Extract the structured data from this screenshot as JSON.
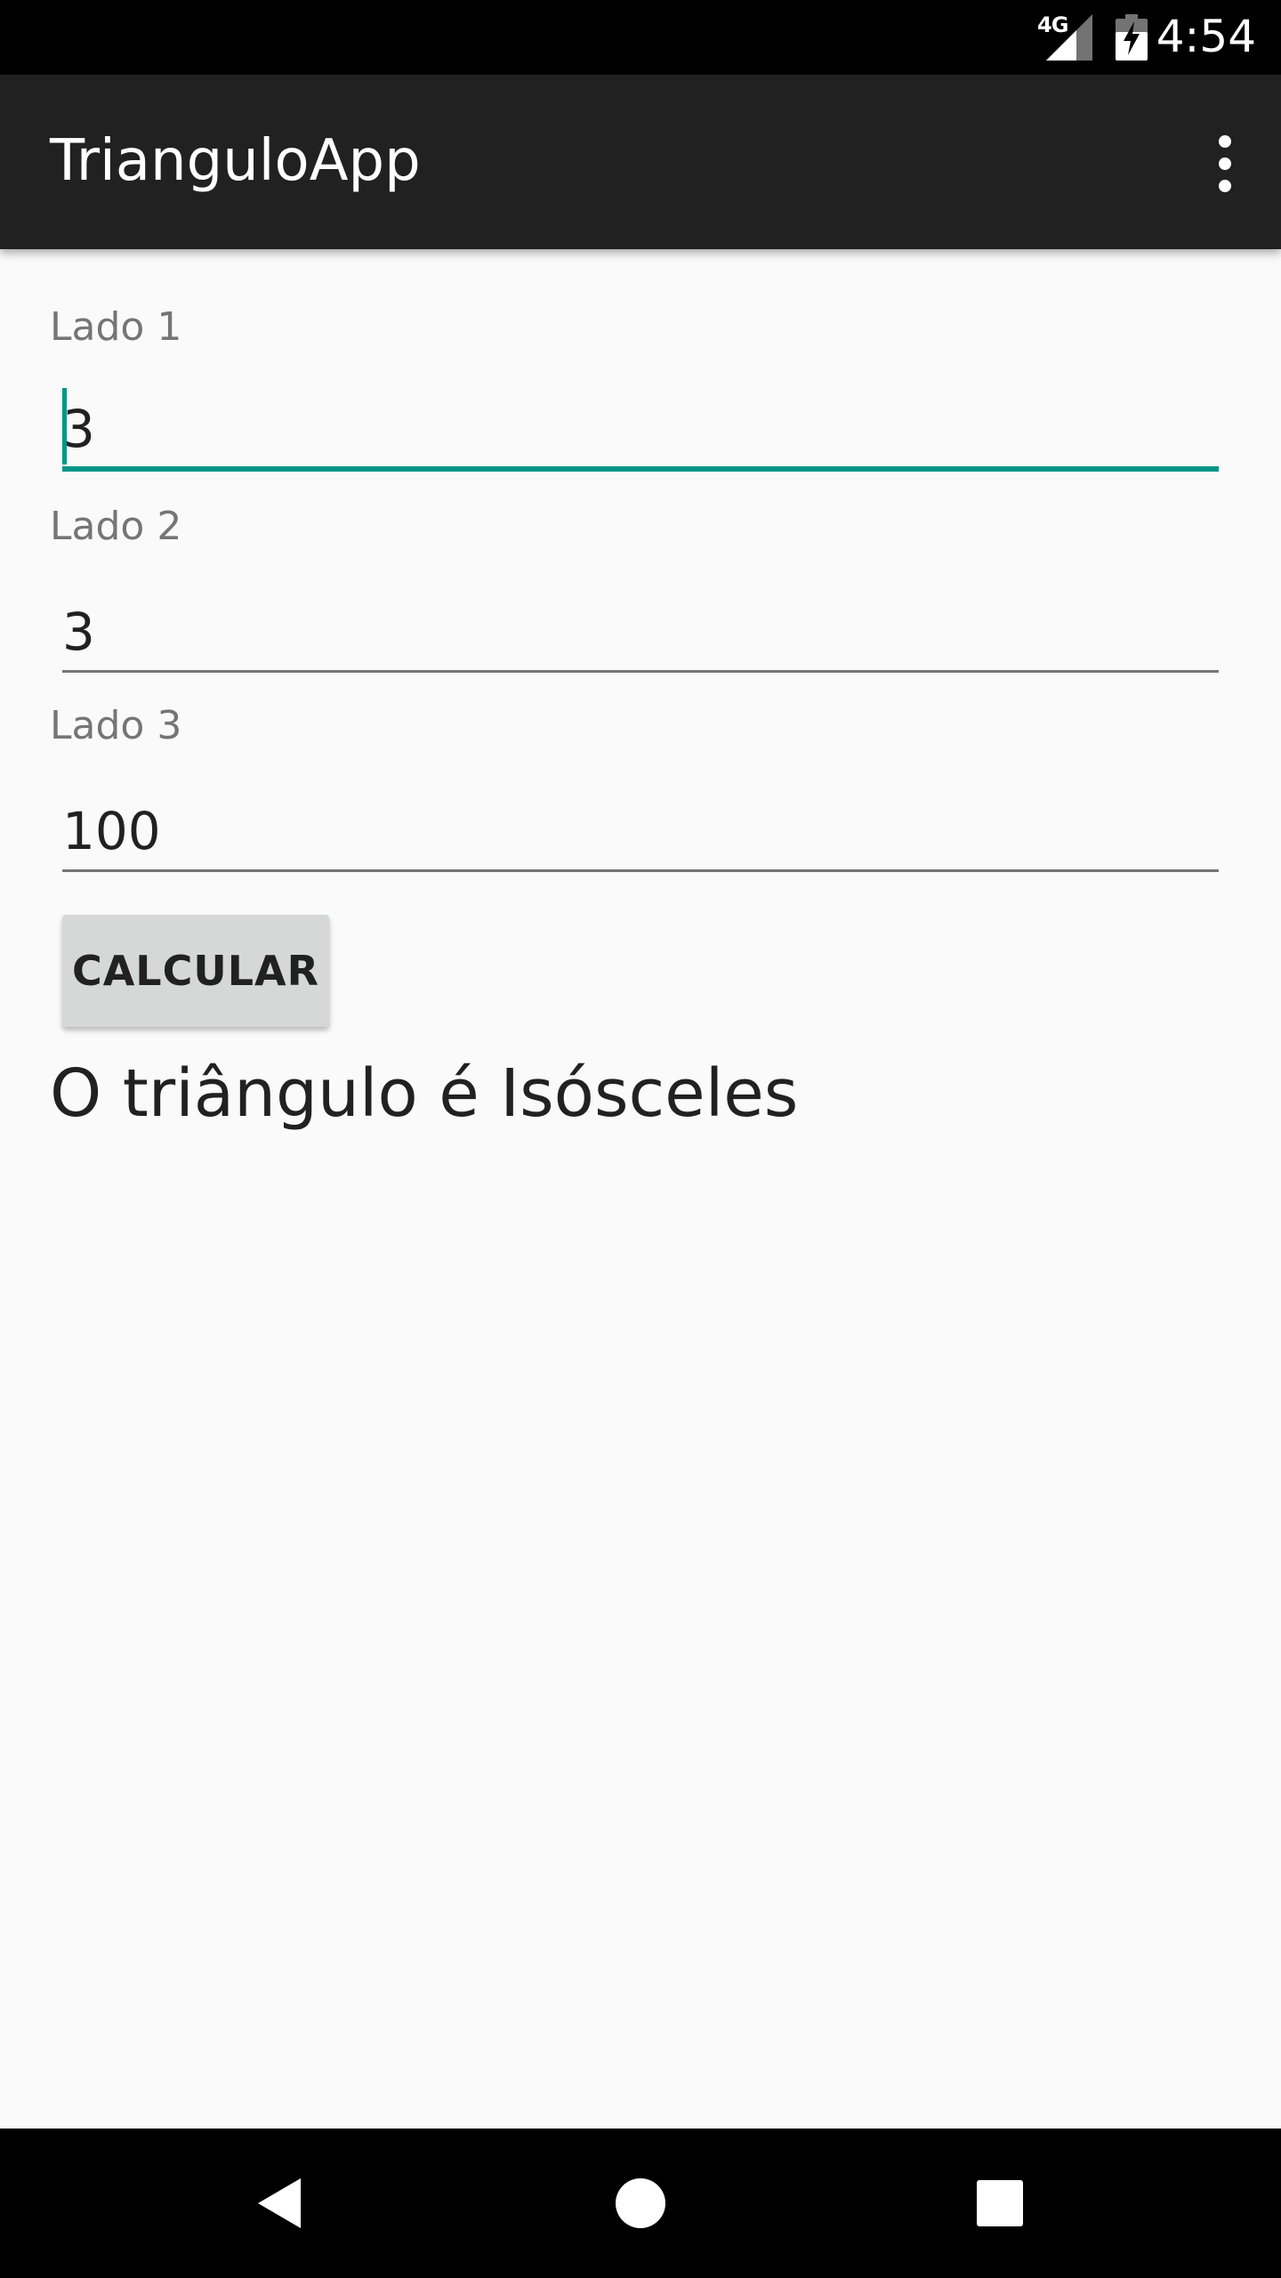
{
  "status_bar": {
    "network": "4G",
    "time": "4:54"
  },
  "app_bar": {
    "title": "TrianguloApp"
  },
  "form": {
    "side1": {
      "label": "Lado 1",
      "value": "3"
    },
    "side2": {
      "label": "Lado 2",
      "value": "3"
    },
    "side3": {
      "label": "Lado 3",
      "value": "100"
    },
    "calculate_label": "CALCULAR"
  },
  "result": {
    "text": "O triângulo é Isósceles"
  },
  "colors": {
    "accent": "#009688",
    "app_bar": "#212121",
    "background": "#fafafa"
  }
}
